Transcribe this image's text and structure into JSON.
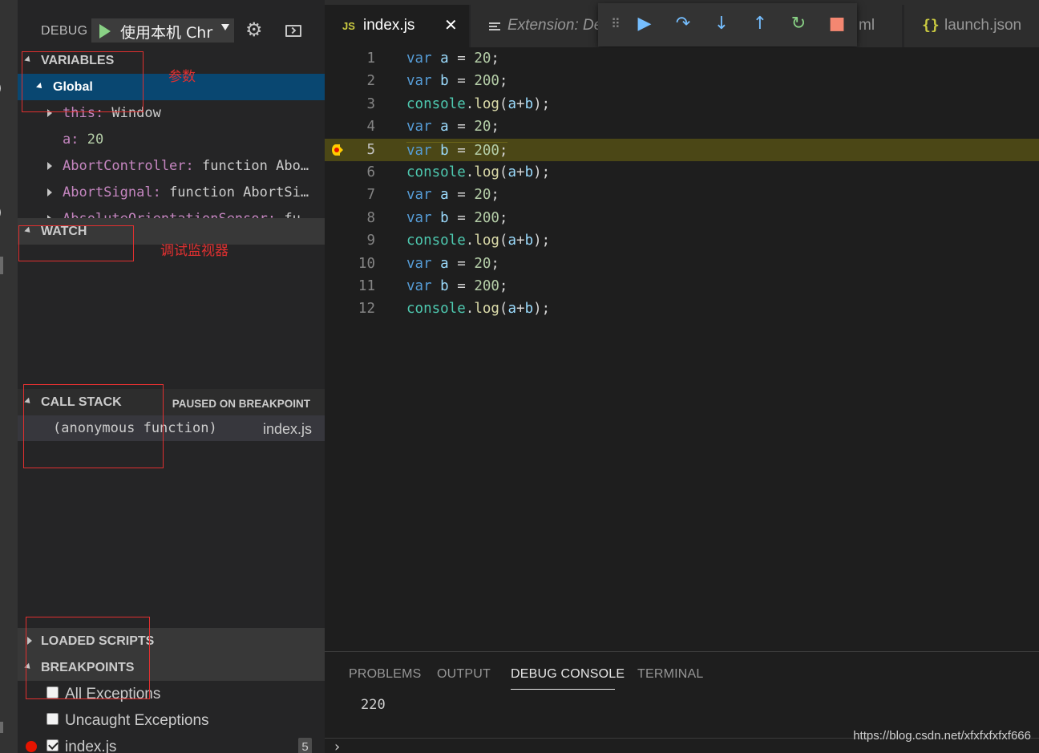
{
  "activity": {
    "glyph_top": ")",
    "glyph_mid": ")"
  },
  "debug": {
    "label": "DEBUG",
    "config": "使用本机 Chr",
    "gear_icon": "gear-icon",
    "console_icon": "debug-console-icon"
  },
  "variables": {
    "header": "VARIABLES",
    "scope": "Global",
    "items": [
      {
        "name": "this:",
        "value": " Window"
      },
      {
        "name": "a:",
        "value": " 20"
      },
      {
        "name": "AbortController:",
        "value": " function Abo…"
      },
      {
        "name": "AbortSignal:",
        "value": " function AbortSi…"
      },
      {
        "name": "AbsoluteOrientationSensor:",
        "value": " fu…"
      }
    ]
  },
  "watch": {
    "header": "WATCH"
  },
  "call_stack": {
    "header": "CALL STACK",
    "status": "PAUSED ON BREAKPOINT",
    "frames": [
      {
        "name": "(anonymous function)",
        "file": "index.js"
      }
    ]
  },
  "loaded_scripts": {
    "header": "LOADED SCRIPTS"
  },
  "breakpoints": {
    "header": "BREAKPOINTS",
    "items": [
      {
        "label": "All Exceptions",
        "checked": false
      },
      {
        "label": "Uncaught Exceptions",
        "checked": false
      },
      {
        "label": "index.js",
        "checked": true,
        "count": "5"
      }
    ]
  },
  "annotations": {
    "params": "参数",
    "watch": "调试监视器"
  },
  "tabs": [
    {
      "label": "index.js",
      "badge": "JS",
      "close": "✕"
    },
    {
      "label": "Extension: De"
    },
    {
      "label": "ml"
    },
    {
      "label": "launch.json",
      "badge": "{}"
    }
  ],
  "debug_toolbar": {
    "grip": "⠿",
    "buttons": [
      {
        "name": "continue",
        "glyph": "▶",
        "color": "#75beff"
      },
      {
        "name": "step-over",
        "glyph": "↷",
        "color": "#75beff"
      },
      {
        "name": "step-into",
        "glyph": "↓",
        "color": "#75beff"
      },
      {
        "name": "step-out",
        "glyph": "↑",
        "color": "#75beff"
      },
      {
        "name": "restart",
        "glyph": "↻",
        "color": "#89d185"
      },
      {
        "name": "stop",
        "glyph": "■",
        "color": "#f48771"
      }
    ]
  },
  "editor": {
    "current_line": 5,
    "lines": [
      {
        "n": "1",
        "kind": "var",
        "name": "a",
        "value": "20"
      },
      {
        "n": "2",
        "kind": "var",
        "name": "b",
        "value": "200"
      },
      {
        "n": "3",
        "kind": "log"
      },
      {
        "n": "4",
        "kind": "var",
        "name": "a",
        "value": "20"
      },
      {
        "n": "5",
        "kind": "var",
        "name": "b",
        "value": "200"
      },
      {
        "n": "6",
        "kind": "log"
      },
      {
        "n": "7",
        "kind": "var",
        "name": "a",
        "value": "20"
      },
      {
        "n": "8",
        "kind": "var",
        "name": "b",
        "value": "200"
      },
      {
        "n": "9",
        "kind": "log"
      },
      {
        "n": "10",
        "kind": "var",
        "name": "a",
        "value": "20"
      },
      {
        "n": "11",
        "kind": "var",
        "name": "b",
        "value": "200"
      },
      {
        "n": "12",
        "kind": "log"
      }
    ],
    "tokens": {
      "kw": "var",
      "eq": " = ",
      "semi": ";",
      "obj": "console",
      "dot": ".",
      "fn": "log",
      "args_open": "(",
      "arg_a": "a",
      "plus": "+",
      "arg_b": "b",
      "args_close": ");"
    }
  },
  "panel": {
    "tabs": [
      "PROBLEMS",
      "OUTPUT",
      "DEBUG CONSOLE",
      "TERMINAL"
    ],
    "active_tab": "DEBUG CONSOLE",
    "output": "220",
    "prompt": "›"
  },
  "watermark": "https://blog.csdn.net/xfxfxfxfxf666"
}
